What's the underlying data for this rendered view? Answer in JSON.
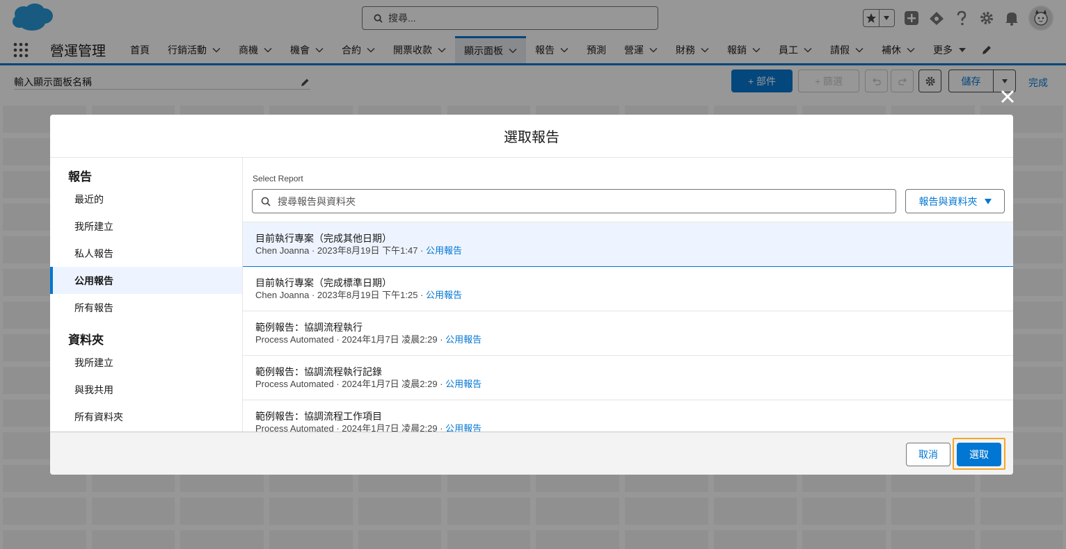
{
  "global_header": {
    "search_placeholder": "搜尋..."
  },
  "nav": {
    "app_name": "營運管理",
    "items": [
      {
        "label": "首頁",
        "chevron": false,
        "active": false
      },
      {
        "label": "行銷活動",
        "chevron": true,
        "active": false
      },
      {
        "label": "商機",
        "chevron": true,
        "active": false
      },
      {
        "label": "機會",
        "chevron": true,
        "active": false
      },
      {
        "label": "合約",
        "chevron": true,
        "active": false
      },
      {
        "label": "開票收款",
        "chevron": true,
        "active": false
      },
      {
        "label": "顯示面板",
        "chevron": true,
        "active": true
      },
      {
        "label": "報告",
        "chevron": true,
        "active": false
      },
      {
        "label": "預測",
        "chevron": false,
        "active": false
      },
      {
        "label": "營運",
        "chevron": true,
        "active": false
      },
      {
        "label": "財務",
        "chevron": true,
        "active": false
      },
      {
        "label": "報銷",
        "chevron": true,
        "active": false
      },
      {
        "label": "員工",
        "chevron": true,
        "active": false
      },
      {
        "label": "請假",
        "chevron": true,
        "active": false
      },
      {
        "label": "補休",
        "chevron": true,
        "active": false
      },
      {
        "label": "更多",
        "chevron": true,
        "active": false
      }
    ]
  },
  "builder": {
    "dashboard_name_placeholder": "輸入顯示面板名稱",
    "add_component_label": "+ 部件",
    "add_filter_label": "+ 篩選",
    "save_label": "儲存",
    "done_label": "完成"
  },
  "modal": {
    "title": "選取報告",
    "sidebar": {
      "reports_heading": "報告",
      "report_items": [
        {
          "label": "最近的",
          "selected": false
        },
        {
          "label": "我所建立",
          "selected": false
        },
        {
          "label": "私人報告",
          "selected": false
        },
        {
          "label": "公用報告",
          "selected": true
        },
        {
          "label": "所有報告",
          "selected": false
        }
      ],
      "folders_heading": "資料夾",
      "folder_items": [
        {
          "label": "我所建立"
        },
        {
          "label": "與我共用"
        },
        {
          "label": "所有資料夾"
        }
      ]
    },
    "select_label": "Select Report",
    "search_placeholder": "搜尋報告與資料夾",
    "filter_button_label": "報告與資料夾",
    "reports": [
      {
        "title": "目前執行專案（完成其他日期）",
        "owner": "Chen Joanna",
        "date": "2023年8月19日 下午1:47",
        "type": "公用報告",
        "selected": true
      },
      {
        "title": "目前執行專案（完成標準日期）",
        "owner": "Chen Joanna",
        "date": "2023年8月19日 下午1:25",
        "type": "公用報告",
        "selected": false
      },
      {
        "title": "範例報告：協調流程執行",
        "owner": "Process Automated",
        "date": "2024年1月7日 凌晨2:29",
        "type": "公用報告",
        "selected": false
      },
      {
        "title": "範例報告：協調流程執行記錄",
        "owner": "Process Automated",
        "date": "2024年1月7日 凌晨2:29",
        "type": "公用報告",
        "selected": false
      },
      {
        "title": "範例報告：協調流程工作項目",
        "owner": "Process Automated",
        "date": "2024年1月7日 凌晨2:29",
        "type": "公用報告",
        "selected": false
      }
    ],
    "cancel_label": "取消",
    "select_button_label": "選取"
  },
  "colors": {
    "brand": "#0176d3",
    "highlight_outline": "#f5a623",
    "selected_row": "#eef4ff"
  }
}
